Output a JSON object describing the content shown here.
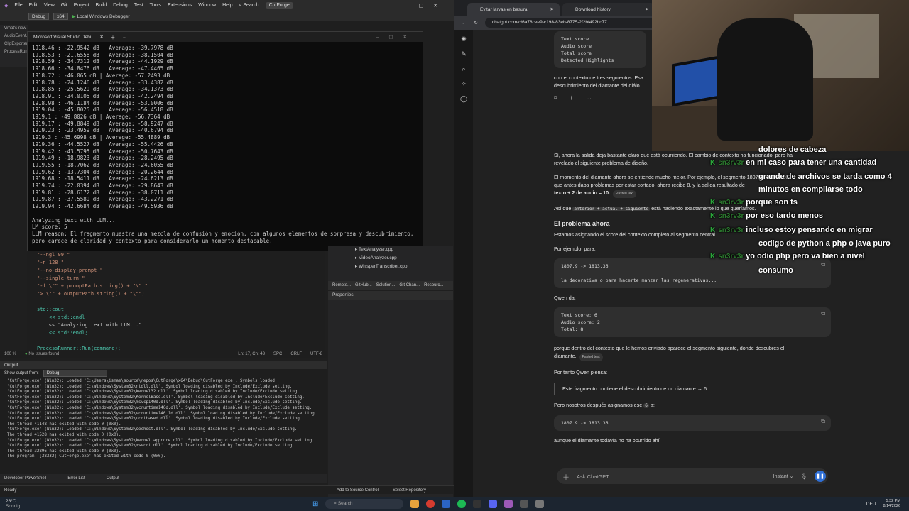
{
  "vs": {
    "menu": [
      "File",
      "Edit",
      "View",
      "Git",
      "Project",
      "Build",
      "Debug",
      "Test",
      "Tools",
      "Extensions",
      "Window",
      "Help"
    ],
    "search_label": "Search",
    "app_title": "CutForge",
    "config": "Debug",
    "platform": "x64",
    "run_target": "Local Windows Debugger",
    "left_items": [
      "What's new",
      "AudioEvent...",
      "ClipExporter",
      "ProcessRunn..."
    ],
    "console_title": "Microsoft Visual Studio Debu",
    "console_lines": [
      "1918.46 : -22.9542 dB | Average: -39.7978 dB",
      "1918.53 : -21.6558 dB | Average: -38.1504 dB",
      "1918.59 : -34.7312 dB | Average: -44.1929 dB",
      "1918.66 : -34.8476 dB | Average: -47.4465 dB",
      "1918.72 : -46.065 dB | Average: -57.2493 dB",
      "1918.78 : -24.1246 dB | Average: -33.4382 dB",
      "1918.85 : -25.5629 dB | Average: -34.1373 dB",
      "1918.91 : -34.0105 dB | Average: -42.2494 dB",
      "1918.98 : -46.1184 dB | Average: -53.0006 dB",
      "1919.04 : -45.8025 dB | Average: -56.4518 dB",
      "1919.1 : -49.8026 dB | Average: -56.7364 dB",
      "1919.17 : -49.8849 dB | Average: -58.9247 dB",
      "1919.23 : -23.4959 dB | Average: -40.6794 dB",
      "1919.3 : -45.6998 dB | Average: -55.4889 dB",
      "1919.36 : -44.5527 dB | Average: -55.4426 dB",
      "1919.42 : -43.5795 dB | Average: -50.7643 dB",
      "1919.49 : -18.9823 dB | Average: -28.2495 dB",
      "1919.55 : -18.7062 dB | Average: -24.6055 dB",
      "1919.62 : -13.7304 dB | Average: -20.2644 dB",
      "1919.68 : -18.5411 dB | Average: -24.6213 dB",
      "1919.74 : -22.0394 dB | Average: -29.8643 dB",
      "1919.81 : -28.6172 dB | Average: -38.0711 dB",
      "1919.87 : -37.5589 dB | Average: -43.2271 dB",
      "1919.94 : -42.6684 dB | Average: -49.5936 dB",
      "",
      "Analyzing text with LLM...",
      "LM score: 5",
      "LLM reason: El fragmento muestra una mezcla de confusión y emoción, con algunos elementos de sorpresa y descubrimiento,",
      "pero carece de claridad y contexto para considerarlo un momento destacable."
    ],
    "code_lines": [
      "\"--ngl 99 \"",
      "\"-n 128 \"",
      "\"--no-display-prompt \"",
      "\"--single-turn \"",
      "\"-f \\\"\" + promptPath.string() + \"\\\" \"",
      "\"> \\\"\" + outputPath.string() + \"\\\"\";",
      "",
      "std::cout",
      "    << std::endl",
      "    << \"Analyzing text with LLM...\"",
      "    << std::endl;",
      "",
      "ProcessRunner::Run(command);",
      "",
      "std::ifstream responseFile(outputPath);",
      "",
      "if (!responseFile.is_open())"
    ],
    "editor_status": {
      "zoom": "100 %",
      "issues": "No issues found",
      "pos": "Ln: 17, Ch: 43",
      "enc1": "SPC",
      "enc2": "CRLF",
      "enc3": "UTF-8"
    },
    "solution_files": [
      "TextAnalyzer.cpp",
      "VideoAnalyzer.cpp",
      "WhisperTranscriber.cpp"
    ],
    "sol_tabs": [
      "Remote...",
      "GitHub...",
      "Solution...",
      "Git Chan...",
      "Resourc..."
    ],
    "properties_title": "Properties",
    "output_title": "Output",
    "output_from_label": "Show output from:",
    "output_from_value": "Debug",
    "output_lines": [
      "'CutForge.exe' (Win32): Loaded 'C:\\Users\\ismae\\source\\repos\\CutForge\\x64\\Debug\\CutForge.exe'. Symbols loaded.",
      "'CutForge.exe' (Win32): Loaded 'C:\\Windows\\System32\\ntdll.dll'. Symbol loading disabled by Include/Exclude setting.",
      "'CutForge.exe' (Win32): Loaded 'C:\\Windows\\System32\\kernel32.dll'. Symbol loading disabled by Include/Exclude setting.",
      "'CutForge.exe' (Win32): Loaded 'C:\\Windows\\System32\\KernelBase.dll'. Symbol loading disabled by Include/Exclude setting.",
      "'CutForge.exe' (Win32): Loaded 'C:\\Windows\\System32\\msvcp140d.dll'. Symbol loading disabled by Include/Exclude setting.",
      "'CutForge.exe' (Win32): Loaded 'C:\\Windows\\System32\\vcruntime140d.dll'. Symbol loading disabled by Include/Exclude setting.",
      "'CutForge.exe' (Win32): Loaded 'C:\\Windows\\System32\\vcruntime140_1d.dll'. Symbol loading disabled by Include/Exclude setting.",
      "'CutForge.exe' (Win32): Loaded 'C:\\Windows\\System32\\ucrtbased.dll'. Symbol loading disabled by Include/Exclude setting.",
      "The thread 41148 has exited with code 0 (0x0).",
      "'CutForge.exe' (Win32): Loaded 'C:\\Windows\\System32\\sechost.dll'. Symbol loading disabled by Include/Exclude setting.",
      "The thread 41528 has exited with code 0 (0x0).",
      "'CutForge.exe' (Win32): Loaded 'C:\\Windows\\System32\\kernel.appcore.dll'. Symbol loading disabled by Include/Exclude setting.",
      "'CutForge.exe' (Win32): Loaded 'C:\\Windows\\System32\\msvcrt.dll'. Symbol loading disabled by Include/Exclude setting.",
      "The thread 32896 has exited with code 0 (0x0).",
      "The program '[38332] CutForge.exe' has exited with code 0 (0x0)."
    ],
    "bottom_tabs": [
      "Developer PowerShell",
      "Error List",
      "Output"
    ],
    "status_ready": "Ready",
    "status_right": [
      "Add to Source Control",
      "Select Repository"
    ]
  },
  "chrome": {
    "tabs": [
      "Evitar larvas en basura",
      "Download history"
    ],
    "url": "chatgpt.com/c/6a78cee9-c198-83eb-8775-2f2bf492bc77"
  },
  "chat": {
    "top_code": [
      "Text score",
      "Audio score",
      "Total score",
      "Detected Highlights"
    ],
    "p1": "con el contexto de tres segmentos. Esa",
    "p1b": "descubrimiento del diamante del diálo",
    "p2": "Sí, ahora la salida deja bastante claro qué está ocurriendo. El cambio de contexto ha funcionado, pero ha",
    "p2b": "revelado el siguiente problema de diseño.",
    "p3": "El momento del diamante ahora se entiende mucho mejor. Por ejemplo, el segmento 1807.9 -> 1813.36",
    "p3b": "que antes daba problemas por estar cortado, ahora recibe 8, y la salida resultado de",
    "p3c": "texto + 2 de audio = 10.",
    "pasted": "Pasted text",
    "p4a": "Así que",
    "p4code": "anterior + actual + siguiente",
    "p4b": "está haciendo exactamente lo que queríamos.",
    "h_problem": "El problema ahora",
    "p5": "Estamos asignando el score del contexto completo al segmento central.",
    "p6": "Por ejemplo, para:",
    "code1": "1807.9 -> 1813.36\n\nla decorativa o para hacerte manzar las regenerativas...",
    "p7": "Qwen da:",
    "code2": "Text score: 6\nAudio score: 2\nTotal: 8",
    "p8": "porque dentro del contexto que le hemos enviado aparece el segmento siguiente, donde descubres el",
    "p8b": "diamante.",
    "p9": "Por tanto Qwen piensa:",
    "quote": "Este fragmento contiene el descubrimiento de un diamante → 6.",
    "p10a": "Pero nosotros después asignamos ese",
    "p10num": "6",
    "p10b": "a:",
    "code3": "1807.9 -> 1813.36",
    "p11": "aunque el diamante todavía no ha ocurrido ahí.",
    "ask_placeholder": "Ask ChatGPT",
    "mode": "Instant"
  },
  "twitch": {
    "lines": [
      {
        "user": "",
        "text": "dolores de cabeza"
      },
      {
        "user": "sn3rv3r",
        "text": "en mi caso para tener una cantidad"
      },
      {
        "user": "",
        "text": "grande de archivos se tarda como 4"
      },
      {
        "user": "",
        "text": "minutos en compilarse todo"
      },
      {
        "user": "sn3rv3r",
        "text": "porque son ts"
      },
      {
        "user": "sn3rv3r",
        "text": "por eso tardo menos"
      },
      {
        "user": "sn3rv3r",
        "text": "incluso estoy pensando en migrar"
      },
      {
        "user": "",
        "text": "codigo de python a php o java puro"
      },
      {
        "user": "sn3rv3r",
        "text": "yo odio php pero va bien a nivel"
      },
      {
        "user": "",
        "text": "consumo"
      }
    ]
  },
  "taskbar": {
    "temp": "28°C",
    "weather": "Sonnig",
    "search": "Search",
    "lang": "DEU",
    "time": "5:32 PM",
    "date": "8/14/2026"
  }
}
